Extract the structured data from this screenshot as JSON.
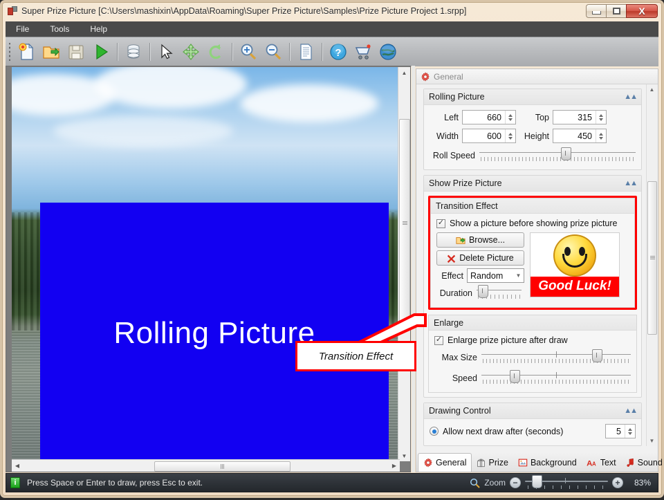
{
  "window": {
    "title": "Super Prize Picture [C:\\Users\\mashixin\\AppData\\Roaming\\Super Prize Picture\\Samples\\Prize Picture Project 1.srpp]",
    "app_icon": "app-logo-icon",
    "minimize_label": "–",
    "maximize_label": "□",
    "close_label": "X"
  },
  "menu": {
    "items": [
      "File",
      "Tools",
      "Help"
    ]
  },
  "toolbar": {
    "buttons": [
      {
        "name": "new-project-icon",
        "tip": "New"
      },
      {
        "name": "open-project-icon",
        "tip": "Open"
      },
      {
        "name": "save-project-icon",
        "tip": "Save"
      },
      {
        "name": "run-play-icon",
        "tip": "Run"
      },
      {
        "name": "database-icon",
        "tip": "Database"
      },
      {
        "name": "select-cursor-icon",
        "tip": "Select"
      },
      {
        "name": "move-icon",
        "tip": "Move"
      },
      {
        "name": "rotate-icon",
        "tip": "Rotate"
      },
      {
        "name": "zoom-in-icon",
        "tip": "Zoom In"
      },
      {
        "name": "zoom-out-icon",
        "tip": "Zoom Out"
      },
      {
        "name": "document-icon",
        "tip": "Document"
      },
      {
        "name": "help-icon",
        "tip": "Help"
      },
      {
        "name": "cart-icon",
        "tip": "Buy"
      },
      {
        "name": "globe-icon",
        "tip": "Website"
      }
    ]
  },
  "canvas": {
    "rolling_picture_label": "Rolling Picture",
    "rolling_picture_color": "#1200f2",
    "background_description": "lake-and-forest-photo"
  },
  "annotation": {
    "label": "Transition Effect",
    "border_color": "#ff0000"
  },
  "panel": {
    "header_title": "General",
    "rolling_picture": {
      "title": "Rolling Picture",
      "collapse_icon": "chevron-up-icon",
      "left_label": "Left",
      "left_value": "660",
      "top_label": "Top",
      "top_value": "315",
      "width_label": "Width",
      "width_value": "600",
      "height_label": "Height",
      "height_value": "450",
      "roll_speed_label": "Roll Speed"
    },
    "show_prize_picture": {
      "title": "Show Prize Picture",
      "collapse_icon": "chevron-up-icon",
      "transition_effect": {
        "title": "Transition Effect",
        "checkbox_label": "Show a picture before showing prize picture",
        "checkbox_checked": true,
        "browse_label": "Browse...",
        "delete_label": "Delete Picture",
        "effect_label": "Effect",
        "effect_value": "Random",
        "duration_label": "Duration",
        "preview_banner_text": "Good Luck!",
        "preview_banner_color": "#ff0000",
        "preview_face": "smiley-face-icon"
      },
      "enlarge": {
        "title": "Enlarge",
        "checkbox_label": "Enlarge prize picture after draw",
        "checkbox_checked": true,
        "max_size_label": "Max Size",
        "speed_label": "Speed"
      }
    },
    "drawing_control": {
      "title": "Drawing Control",
      "collapse_icon": "chevron-up-icon",
      "allow_next_draw_label": "Allow next draw after (seconds)",
      "allow_next_draw_value": "5",
      "allow_next_draw_selected": true
    }
  },
  "tabs": [
    {
      "label": "General",
      "icon": "gear-icon",
      "active": true
    },
    {
      "label": "Prize",
      "icon": "gift-icon",
      "active": false
    },
    {
      "label": "Background",
      "icon": "image-icon",
      "active": false
    },
    {
      "label": "Text",
      "icon": "font-icon",
      "active": false
    },
    {
      "label": "Sound",
      "icon": "music-note-icon",
      "active": false
    }
  ],
  "statusbar": {
    "info_icon": "info-icon",
    "message": "Press Space or Enter to draw, press Esc to exit.",
    "zoom_icon": "magnifier-icon",
    "zoom_label": "Zoom",
    "zoom_out_label": "−",
    "zoom_in_label": "+",
    "zoom_percent": "83%"
  }
}
